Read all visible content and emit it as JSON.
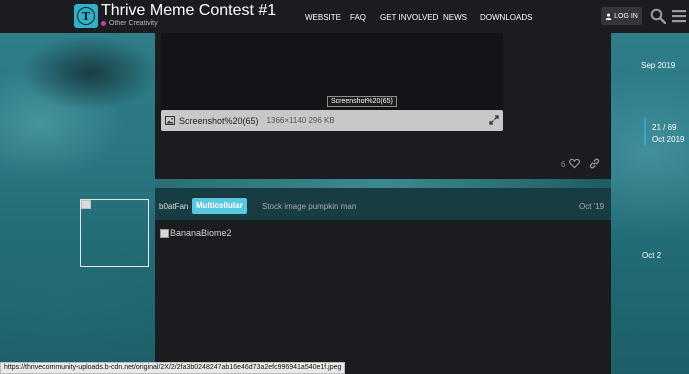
{
  "header": {
    "title": "Thrive Meme Contest #1",
    "category": "Other Creativity",
    "category_color": "#b246b4",
    "logo_letter": "T",
    "nav": [
      "WEBSITE",
      "FAQ",
      "GET INVOLVED",
      "NEWS",
      "DOWNLOADS"
    ],
    "login_label": "LOG IN",
    "accent": "#2fb2c7"
  },
  "post1": {
    "tooltip": "Screenshot%20(65)",
    "lightbox_title": "Screenshot%20(65)",
    "lightbox_meta": "1366×1140 296 KB",
    "like_count": "6"
  },
  "post2": {
    "username": "b0atFan",
    "badge": "Multicellular",
    "badge_color": "#5bc7e0",
    "summary": "Stock image pumpkin man",
    "date": "Oct '19",
    "image_alt": "BananaBiome2"
  },
  "timeline": {
    "top_date": "Sep 2019",
    "position": "21 / 69",
    "position_date": "Oct 2019",
    "bottom_date": "Oct 2"
  },
  "status_bar": {
    "url": "https://thrivecommunity-uploads.b-cdn.net/original/2X/2/2fa3b0248247ab16e46d73a2efc996941a540e1f.jpeg"
  }
}
